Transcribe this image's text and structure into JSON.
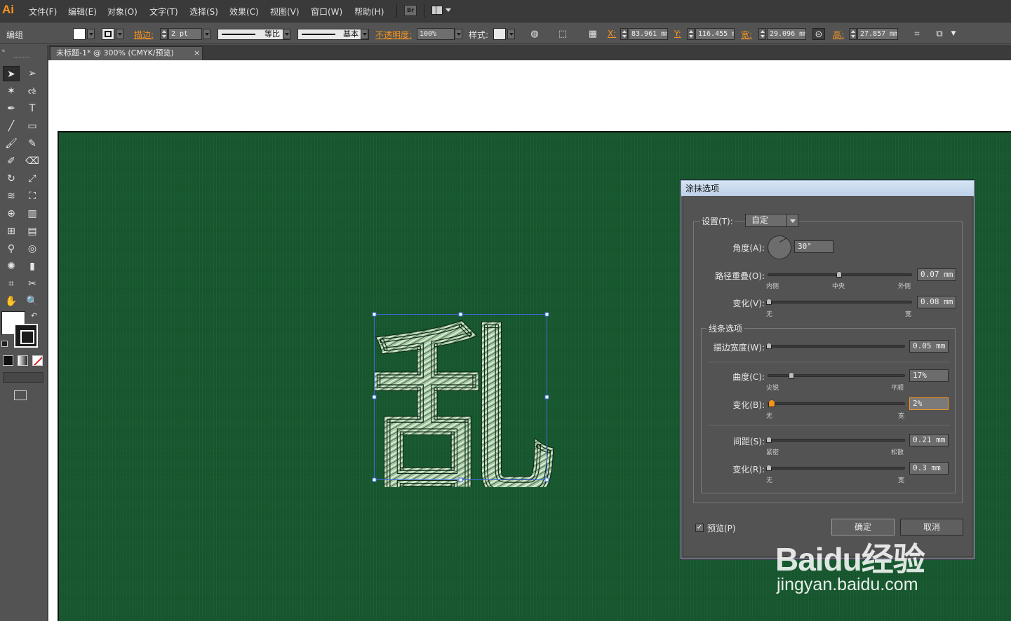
{
  "app": {
    "logo": "Ai"
  },
  "menu": {
    "items": [
      "文件(F)",
      "编辑(E)",
      "对象(O)",
      "文字(T)",
      "选择(S)",
      "效果(C)",
      "视图(V)",
      "窗口(W)",
      "帮助(H)"
    ],
    "bridge_label": "Br"
  },
  "control": {
    "selection_type": "编组",
    "stroke_label": "描边:",
    "stroke_weight": "2 pt",
    "stroke_profile": "等比",
    "brush": "基本",
    "opacity_label": "不透明度:",
    "opacity_value": "100%",
    "style_label": "样式:",
    "x_label": "X:",
    "x_value": "83.961 mm",
    "y_label": "Y:",
    "y_value": "116.455 mm",
    "w_label": "宽:",
    "w_value": "29.096 mm",
    "h_label": "高:",
    "h_value": "27.857 mm"
  },
  "document": {
    "tab_title": "未标题-1* @ 300% (CMYK/预览)",
    "close": "×"
  },
  "artwork": {
    "glyph": "乱",
    "background_color": "#17582f"
  },
  "dialog": {
    "title": "涂抹选项",
    "settings_label": "设置(T):",
    "settings_value": "自定",
    "angle_label": "角度(A):",
    "angle_value": "30°",
    "path_overlap_label": "路径重叠(O):",
    "path_overlap_value": "0.07 mm",
    "path_overlap_ticks": [
      "内侧",
      "中央",
      "外侧"
    ],
    "variation1_label": "变化(V):",
    "variation1_value": "0.08 mm",
    "variation1_ticks": [
      "无",
      "宽"
    ],
    "line_options_label": "线条选项",
    "stroke_width_label": "描边宽度(W):",
    "stroke_width_value": "0.05 mm",
    "curviness_label": "曲度(C):",
    "curviness_value": "17%",
    "curviness_ticks": [
      "尖锐",
      "平顺"
    ],
    "variation2_label": "变化(B):",
    "variation2_value": "2%",
    "variation2_ticks": [
      "无",
      "宽"
    ],
    "spacing_label": "间距(S):",
    "spacing_value": "0.21 mm",
    "spacing_ticks": [
      "紧密",
      "松散"
    ],
    "variation3_label": "变化(R):",
    "variation3_value": "0.3 mm",
    "variation3_ticks": [
      "无",
      "宽"
    ],
    "preview_label": "预览(P)",
    "ok_label": "确定",
    "cancel_label": "取消"
  },
  "watermark": {
    "logo": "Baidu经验",
    "url": "jingyan.baidu.com"
  }
}
